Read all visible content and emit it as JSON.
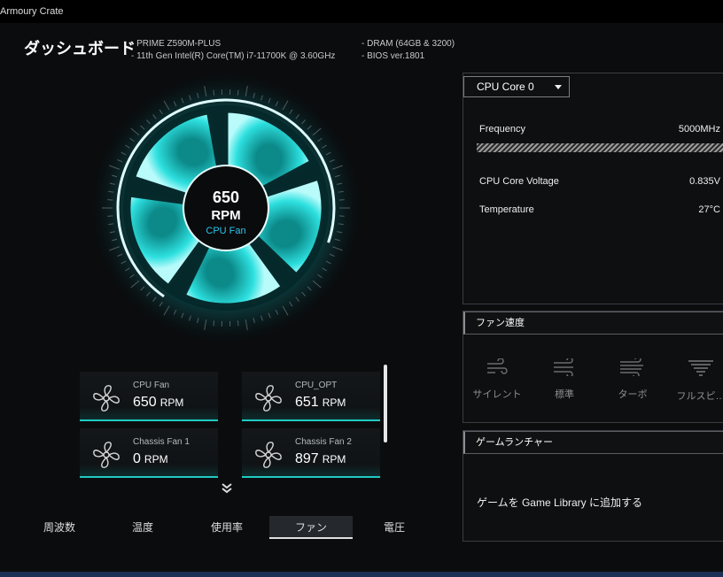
{
  "app": {
    "title": "Armoury Crate"
  },
  "page_title": "ダッシュボード",
  "sysinfo": {
    "col1": [
      "PRIME Z590M-PLUS",
      "11th Gen Intel(R) Core(TM) i7-11700K @ 3.60GHz"
    ],
    "col2": [
      "DRAM (64GB & 3200)",
      "BIOS ver.1801"
    ]
  },
  "gauge": {
    "value": "650",
    "unit": "RPM",
    "name": "CPU Fan"
  },
  "fans": [
    {
      "name": "CPU Fan",
      "value": "650",
      "unit": "RPM"
    },
    {
      "name": "CPU_OPT",
      "value": "651",
      "unit": "RPM"
    },
    {
      "name": "Chassis Fan 1",
      "value": "0",
      "unit": "RPM"
    },
    {
      "name": "Chassis Fan 2",
      "value": "897",
      "unit": "RPM"
    }
  ],
  "tabs": [
    "周波数",
    "温度",
    "使用率",
    "ファン",
    "電圧"
  ],
  "active_tab": "ファン",
  "cpu_panel": {
    "dropdown": "CPU Core 0",
    "rows": [
      {
        "label": "Frequency",
        "value": "5000MHz"
      },
      {
        "label": "CPU Core Voltage",
        "value": "0.835V"
      },
      {
        "label": "Temperature",
        "value": "27°C"
      }
    ]
  },
  "fan_speed_panel": {
    "title": "ファン速度",
    "modes": [
      "サイレント",
      "標準",
      "ターボ",
      "フルスピ…"
    ]
  },
  "game_launcher_panel": {
    "title": "ゲームランチャー",
    "text": "ゲームを Game Library に追加する"
  },
  "colors": {
    "accent": "#1fd1c8",
    "background": "#0b0c0e"
  }
}
